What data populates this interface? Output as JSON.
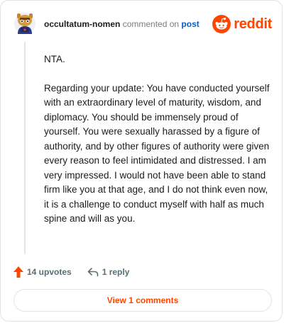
{
  "comment": {
    "username": "occultatum-nomen",
    "action": "commented on",
    "post_link": "post",
    "avatar_icon": "snoo-avatar-icon",
    "paragraphs": [
      "NTA.",
      "Regarding your update: You have conducted yourself with an extraordinary level of maturity, wisdom, and diplomacy. You should be immensely proud of yourself. You were sexually harassed by a figure of authority, and by other figures of authority were given every reason to feel intimidated and distressed. I am very impressed. I would not have been able to stand firm like you at that age, and I do not think even now, it is a challenge to conduct myself with half as much spine and will as you."
    ]
  },
  "brand": {
    "name": "reddit",
    "icon": "reddit-logo-icon",
    "color": "#ff4500"
  },
  "footer": {
    "upvotes_label": "14 upvotes",
    "upvote_icon": "upvote-arrow-icon",
    "reply_label": "1 reply",
    "reply_icon": "reply-arrow-icon"
  },
  "view_comments_label": "View 1 comments",
  "colors": {
    "accent": "#ff4500",
    "link": "#0a5dc2",
    "muted": "#576f76",
    "border": "#e3e3e3"
  }
}
